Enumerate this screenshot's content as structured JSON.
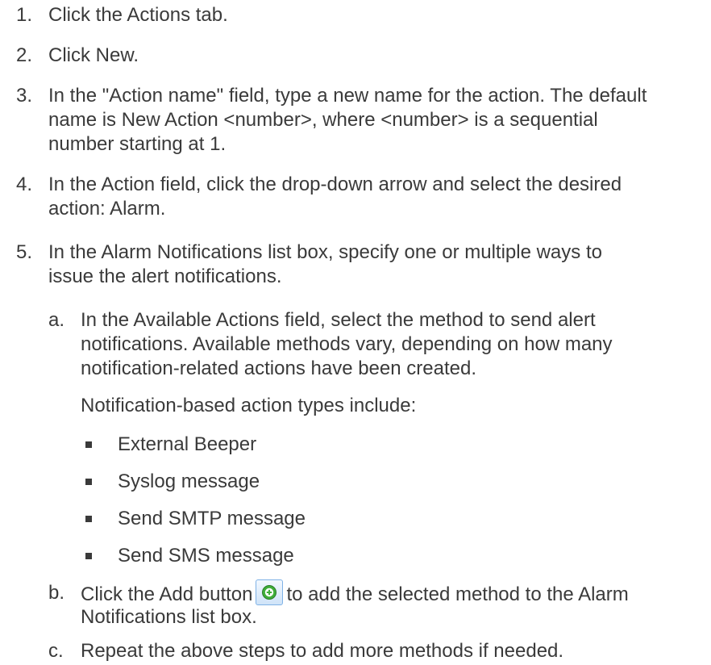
{
  "steps": [
    {
      "num": "1.",
      "lines": [
        "Click the Actions tab."
      ]
    },
    {
      "num": "2.",
      "lines": [
        "Click New."
      ]
    },
    {
      "num": "3.",
      "lines": [
        "In the \"Action name\" field, type a new name for the action. The default",
        "name is New Action <number>, where <number> is a sequential",
        "number starting at 1."
      ]
    },
    {
      "num": "4.",
      "lines": [
        "In the Action field, click the drop-down arrow and select the desired",
        "action: Alarm."
      ]
    },
    {
      "num": "5.",
      "lines": [
        "In the Alarm Notifications list box, specify one or multiple ways to",
        "issue the alert notifications."
      ]
    }
  ],
  "substeps": {
    "a": {
      "marker": "a.",
      "lines": [
        "In the Available Actions field, select the method to send alert",
        "notifications. Available methods vary, depending on how many",
        "notification-related actions have been created."
      ],
      "intro": "Notification-based action types include:",
      "bullets": [
        "External Beeper",
        "Syslog message",
        "Send SMTP message",
        "Send SMS message"
      ]
    },
    "b": {
      "marker": "b.",
      "before_icon": "Click the Add button",
      "after_icon": "to add the selected method to the Alarm",
      "line2": "Notifications list box.",
      "icon": "add-circle-icon"
    },
    "c": {
      "marker": "c.",
      "lines": [
        "Repeat the above steps to add more methods if needed."
      ]
    }
  }
}
